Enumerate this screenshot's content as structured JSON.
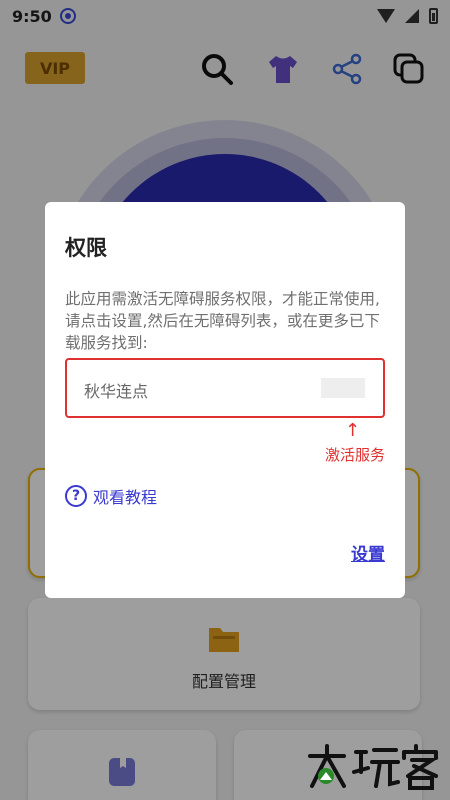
{
  "status_bar": {
    "time": "9:50"
  },
  "topbar": {
    "vip_label": "VIP"
  },
  "cards": {
    "config_label": "配置管理"
  },
  "dialog": {
    "title": "权限",
    "message": "此应用需激活无障碍服务权限，才能正常使用,请点击设置,然后在无障碍列表，或在更多已下载服务找到:",
    "service_name": "秋华连点",
    "arrow": "↑",
    "hint": "激活服务",
    "tutorial_label": "观看教程",
    "settings_label": "设置"
  },
  "colors": {
    "accent": "#3a3ad0",
    "highlight": "#e03030",
    "vip": "#d9a22c",
    "orb": "#2a2ab0"
  },
  "icons": [
    "location-icon",
    "wifi-icon",
    "signal-icon",
    "battery-icon",
    "search-icon",
    "tshirt-icon",
    "share-icon",
    "copy-icon",
    "folder-icon",
    "help-icon"
  ]
}
